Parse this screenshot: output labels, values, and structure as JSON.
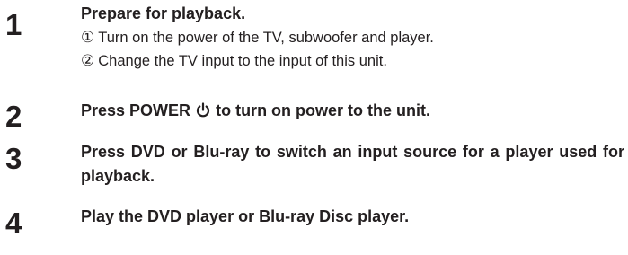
{
  "steps": [
    {
      "number": "1",
      "title": "Prepare for playback.",
      "substeps": [
        {
          "marker": "①",
          "text": "Turn on the power of the TV, subwoofer and player."
        },
        {
          "marker": "②",
          "text": "Change the TV input to the input of this unit."
        }
      ]
    },
    {
      "number": "2",
      "title_before": "Press POWER",
      "icon": "power-icon",
      "title_after": "to turn on power to the unit."
    },
    {
      "number": "3",
      "title": "Press DVD or Blu-ray to switch an input source for a player used for playback."
    },
    {
      "number": "4",
      "title": "Play the DVD player or Blu-ray Disc player."
    }
  ],
  "colors": {
    "text": "#231f20",
    "background": "#ffffff"
  }
}
